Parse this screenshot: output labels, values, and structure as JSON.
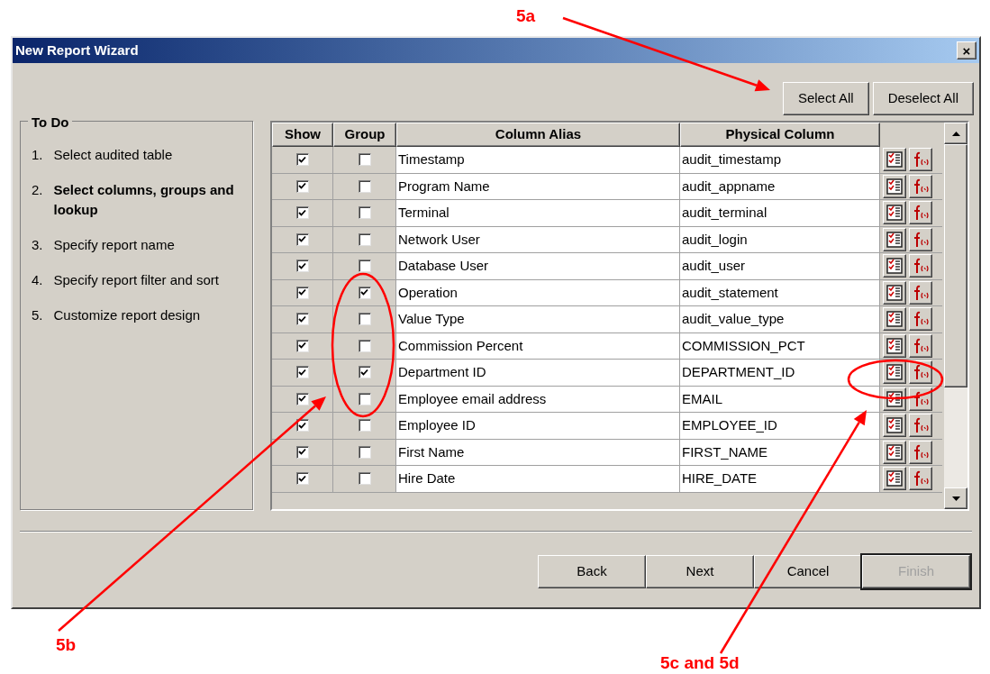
{
  "window": {
    "title": "New Report Wizard",
    "close": "×"
  },
  "top_buttons": [
    "Select All",
    "Deselect All"
  ],
  "todo": {
    "title": "To Do",
    "steps": [
      {
        "number": "1.",
        "label": "Select audited table",
        "selected": false
      },
      {
        "number": "2.",
        "label": "Select columns, groups and lookup",
        "selected": true
      },
      {
        "number": "3.",
        "label": "Specify report name",
        "selected": false
      },
      {
        "number": "4.",
        "label": "Specify report filter and sort",
        "selected": false
      },
      {
        "number": "5.",
        "label": "Customize report design",
        "selected": false
      }
    ]
  },
  "table": {
    "columns": [
      "Show",
      "Group",
      "Column Alias",
      "Physical Column"
    ],
    "rows": [
      {
        "show": true,
        "group": false,
        "alias": "Timestamp",
        "physical": "audit_timestamp"
      },
      {
        "show": true,
        "group": false,
        "alias": "Program Name",
        "physical": "audit_appname"
      },
      {
        "show": true,
        "group": false,
        "alias": "Terminal",
        "physical": "audit_terminal"
      },
      {
        "show": true,
        "group": false,
        "alias": "Network User",
        "physical": "audit_login"
      },
      {
        "show": true,
        "group": false,
        "alias": "Database User",
        "physical": "audit_user"
      },
      {
        "show": true,
        "group": true,
        "alias": "Operation",
        "physical": "audit_statement"
      },
      {
        "show": true,
        "group": false,
        "alias": "Value Type",
        "physical": "audit_value_type"
      },
      {
        "show": true,
        "group": false,
        "alias": "Commission Percent",
        "physical": "COMMISSION_PCT"
      },
      {
        "show": true,
        "group": true,
        "alias": "Department ID",
        "physical": "DEPARTMENT_ID"
      },
      {
        "show": true,
        "group": false,
        "alias": "Employee email address",
        "physical": "EMAIL"
      },
      {
        "show": true,
        "group": false,
        "alias": "Employee ID",
        "physical": "EMPLOYEE_ID"
      },
      {
        "show": true,
        "group": false,
        "alias": "First Name",
        "physical": "FIRST_NAME"
      },
      {
        "show": true,
        "group": false,
        "alias": "Hire Date",
        "physical": "HIRE_DATE"
      }
    ]
  },
  "bottom_buttons": [
    {
      "label": "Back",
      "disabled": false
    },
    {
      "label": "Next",
      "disabled": false
    },
    {
      "label": "Cancel",
      "disabled": false
    },
    {
      "label": "Finish",
      "disabled": true
    }
  ],
  "annotations": [
    {
      "label": "5a"
    },
    {
      "label": "5b"
    },
    {
      "label": "5c and 5d"
    }
  ]
}
